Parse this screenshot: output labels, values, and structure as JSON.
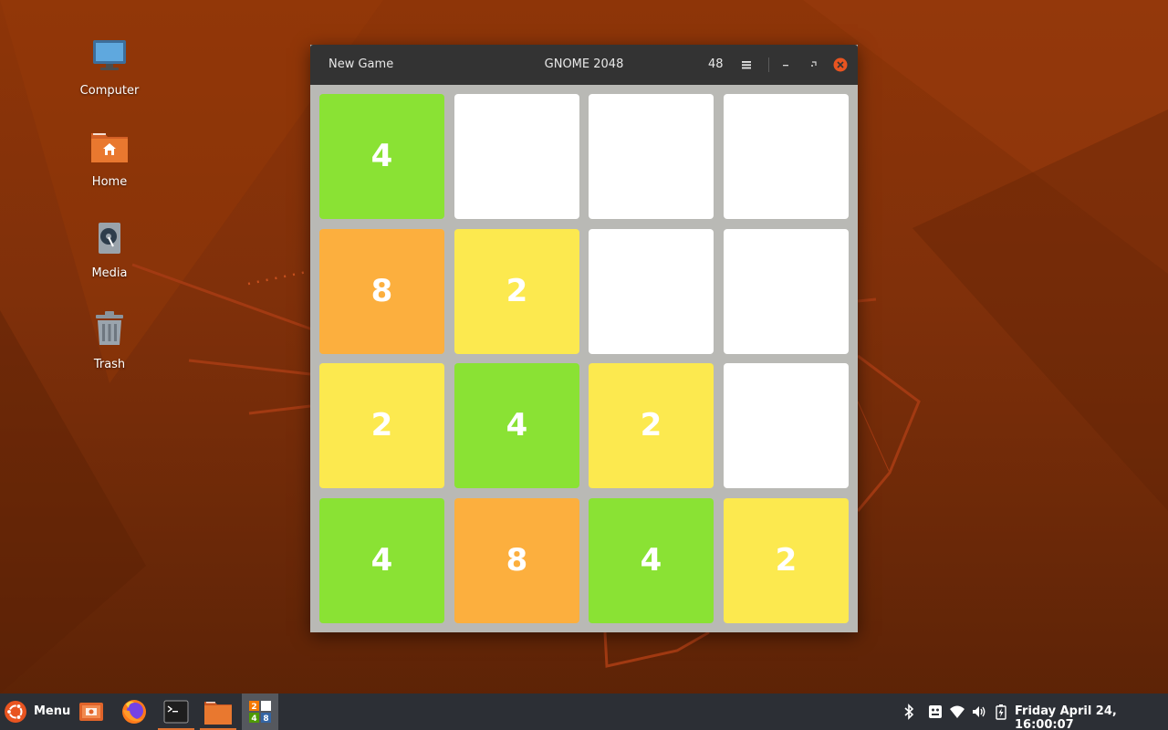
{
  "desktop": {
    "icons": [
      {
        "label": "Computer"
      },
      {
        "label": "Home"
      },
      {
        "label": "Media"
      },
      {
        "label": "Trash"
      }
    ]
  },
  "window": {
    "title": "GNOME 2048",
    "new_game_label": "New Game",
    "score": "48"
  },
  "board": {
    "size": 4,
    "rows": [
      [
        4,
        0,
        0,
        0
      ],
      [
        8,
        2,
        0,
        0
      ],
      [
        2,
        4,
        2,
        0
      ],
      [
        4,
        8,
        4,
        2
      ]
    ]
  },
  "tile_colors": {
    "0": "#ffffff",
    "2": "#fce94f",
    "4": "#8ae234",
    "8": "#fcaf3e"
  },
  "taskbar": {
    "menu_label": "Menu",
    "apps": [
      "screenshot-app",
      "firefox",
      "terminal",
      "files",
      "gnome-2048"
    ],
    "active_app": "gnome-2048",
    "clock": "Friday April 24, 16:00:07"
  }
}
